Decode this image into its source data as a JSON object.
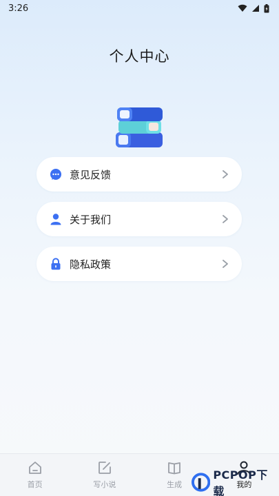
{
  "status_bar": {
    "time": "3:26"
  },
  "page": {
    "title": "个人中心"
  },
  "menu": [
    {
      "label": "意见反馈",
      "icon": "chat-bubble-icon"
    },
    {
      "label": "关于我们",
      "icon": "person-icon"
    },
    {
      "label": "隐私政策",
      "icon": "lock-icon"
    }
  ],
  "tabbar": [
    {
      "label": "首页",
      "icon": "home-icon"
    },
    {
      "label": "写小说",
      "icon": "edit-icon"
    },
    {
      "label": "生成",
      "icon": "book-icon"
    },
    {
      "label": "我的",
      "icon": "profile-icon",
      "active": true
    }
  ],
  "watermark": {
    "text": "PCPOP下载"
  },
  "colors": {
    "accent": "#2f6ff0",
    "background_top": "#dcebfb",
    "card": "#ffffff"
  }
}
